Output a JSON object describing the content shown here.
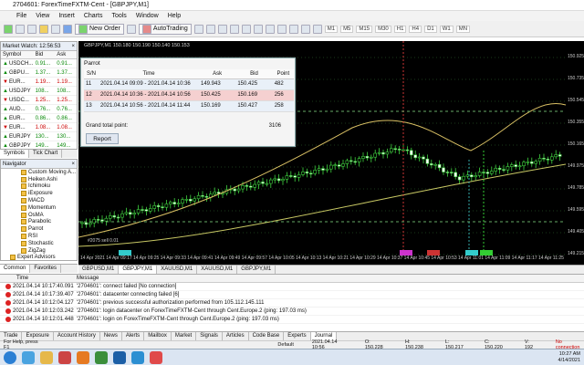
{
  "window": {
    "title": "2704601: ForexTimeFXTM-Cent - [GBPJPY,M1]"
  },
  "menu": [
    "File",
    "View",
    "Insert",
    "Charts",
    "Tools",
    "Window",
    "Help"
  ],
  "toolbar": {
    "new_order": "New Order",
    "autotrading": "AutoTrading",
    "timeframes": [
      "M1",
      "M5",
      "M15",
      "M30",
      "H1",
      "H4",
      "D1",
      "W1",
      "MN"
    ]
  },
  "market_watch": {
    "title": "Market Watch: 12:56:53",
    "headers": [
      "Symbol",
      "Bid",
      "Ask"
    ],
    "rows": [
      {
        "symbol": "USDCH...",
        "bid": "0.91...",
        "ask": "0.91...",
        "dir": "up"
      },
      {
        "symbol": "GBPU...",
        "bid": "1.37...",
        "ask": "1.37...",
        "dir": "up"
      },
      {
        "symbol": "EUR...",
        "bid": "1.19...",
        "ask": "1.19...",
        "dir": "dn"
      },
      {
        "symbol": "USDJPY",
        "bid": "108...",
        "ask": "108...",
        "dir": "up"
      },
      {
        "symbol": "USDC...",
        "bid": "1.25...",
        "ask": "1.25...",
        "dir": "dn"
      },
      {
        "symbol": "AUD...",
        "bid": "0.76...",
        "ask": "0.76...",
        "dir": "up"
      },
      {
        "symbol": "EUR...",
        "bid": "0.86...",
        "ask": "0.86...",
        "dir": "up"
      },
      {
        "symbol": "EUR...",
        "bid": "1.08...",
        "ask": "1.08...",
        "dir": "dn"
      },
      {
        "symbol": "EURJPY",
        "bid": "130...",
        "ask": "130...",
        "dir": "up"
      },
      {
        "symbol": "GBPJPY",
        "bid": "149...",
        "ask": "149...",
        "dir": "up"
      },
      {
        "symbol": "EUR...",
        "bid": "0.91...",
        "ask": "0.91...",
        "dir": "dn"
      }
    ],
    "tabs": [
      "Symbols",
      "Tick Chart"
    ]
  },
  "navigator": {
    "title": "Navigator",
    "items": [
      "Custom Moving A...",
      "Heiken Ashi",
      "Ichimoku",
      "iExposure",
      "MACD",
      "Momentum",
      "OsMA",
      "Parabolic",
      "Parrot",
      "RSI",
      "Stochastic",
      "ZigZag",
      "Expert Advisors"
    ],
    "tabs": [
      "Common",
      "Favorites"
    ]
  },
  "chart": {
    "title": "GBPJPY,M1  150.180 150.190 150.140 150.153",
    "prices": [
      "150.925",
      "150.735",
      "150.545",
      "150.355",
      "150.165",
      "149.975",
      "149.785",
      "149.595",
      "149.405",
      "149.215"
    ],
    "times": [
      "14 Apr 2021",
      "14 Apr 09:17",
      "14 Apr 09:25",
      "14 Apr 09:33",
      "14 Apr 09:41",
      "14 Apr 09:49",
      "14 Apr 09:57",
      "14 Apr 10:05",
      "14 Apr 10:13",
      "14 Apr 10:21",
      "14 Apr 10:29",
      "14 Apr 10:37",
      "14 Apr 10:45",
      "14 Apr 10:53",
      "14 Apr 11:01",
      "14 Apr 11:09",
      "14 Apr 11:17",
      "14 Apr 11:25"
    ],
    "tabs": [
      "GBPUSD,M1",
      "GBPJPY,M1",
      "XAUUSD,M1",
      "XAUUSD,M1",
      "GBPJPY,M1"
    ],
    "note": "#2075 sell 0.01"
  },
  "parrot": {
    "title": "Parrot",
    "headers": [
      "S/N",
      "Time",
      "Ask",
      "Bid",
      "Point"
    ],
    "rows": [
      {
        "sn": "11",
        "time": "2021.04.14 09:09 - 2021.04.14 10:36",
        "ask": "149.943",
        "bid": "150.425",
        "point": "482"
      },
      {
        "sn": "12",
        "time": "2021.04.14 10:36 - 2021.04.14 10:56",
        "ask": "150.425",
        "bid": "150.169",
        "point": "256"
      },
      {
        "sn": "13",
        "time": "2021.04.14 10:56 - 2021.04.14 11:44",
        "ask": "150.169",
        "bid": "150.427",
        "point": "258"
      }
    ],
    "grand_label": "Grand total point:",
    "grand_value": "3106",
    "report_label": "Report"
  },
  "terminal": {
    "headers": [
      "Time",
      "Message"
    ],
    "rows": [
      {
        "time": "2021.04.14 10:17:40.091",
        "msg": "'2704601': connect failed [No connection]"
      },
      {
        "time": "2021.04.14 10:17:39.407",
        "msg": "'2704601': datacenter connecting failed [6]"
      },
      {
        "time": "2021.04.14 10:12:04.127",
        "msg": "'2704601': previous successful authorization performed from 105.112.145.111"
      },
      {
        "time": "2021.04.14 10:12:03.242",
        "msg": "'2704601': login datacenter on ForexTimeFXTM-Cent through Cent.Europe.2 (ping: 197.03 ms)"
      },
      {
        "time": "2021.04.14 10:12:01.448",
        "msg": "'2704601': login on ForexTimeFXTM-Cent through Cent.Europe.2 (ping: 197.03 ms)"
      }
    ],
    "tabs": [
      "Trade",
      "Exposure",
      "Account History",
      "News",
      "Alerts",
      "Mailbox",
      "Market",
      "Signals",
      "Articles",
      "Code Base",
      "Experts",
      "Journal"
    ]
  },
  "status": {
    "help": "For Help, press F1",
    "profile": "Default",
    "dt": "2021.04.14 10:56",
    "o": "O: 150.228",
    "h": "H: 150.238",
    "l": "L: 150.217",
    "c": "C: 150.220",
    "v": "V: 192",
    "conn": "No connection"
  },
  "clock": {
    "time": "10:27 AM",
    "date": "4/14/2021"
  }
}
